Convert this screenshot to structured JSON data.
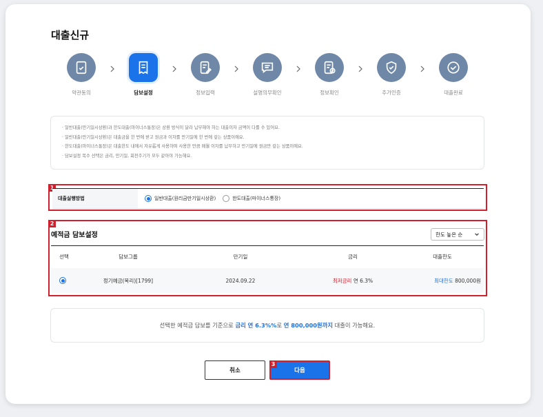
{
  "page": {
    "title": "대출신규"
  },
  "steps": [
    {
      "label": "약관동의",
      "icon": "document-check-icon",
      "active": false
    },
    {
      "label": "담보설정",
      "icon": "receipt-icon",
      "active": true
    },
    {
      "label": "정보입력",
      "icon": "document-edit-icon",
      "active": false
    },
    {
      "label": "설명의무확인",
      "icon": "message-icon",
      "active": false
    },
    {
      "label": "정보확인",
      "icon": "document-verified-icon",
      "active": false
    },
    {
      "label": "추가인증",
      "icon": "shield-check-icon",
      "active": false
    },
    {
      "label": "대출완료",
      "icon": "check-circle-icon",
      "active": false
    }
  ],
  "notice": [
    "일반대출(만기일시상환)과 한도대출(마이너스통장)은 상환 방식이 달라 납부해야 하는 대출이자 금액이 다를 수 있어요.",
    "일반대출(만기일시상환)은 대출금을 한 번에 받고 원금과 이자를 만기일에 한 번에 갚는 상품이에요.",
    "한도대출(마이너스통장)은 대출한도 내에서 자유롭게 사용하며 사용한 만큼 매월 이자를 납부하고 만기일에 원금만 갚는 상품이에요.",
    "담보설정 복수 선택은 금리, 만기일, 회전주기가 모두 같아야 가능해요."
  ],
  "highlights": [
    "1",
    "2",
    "3"
  ],
  "method": {
    "label": "대출실행방법",
    "options": [
      {
        "label": "일반대출(원리금만기일시상환)",
        "selected": true
      },
      {
        "label": "한도대출(마이너스통장)",
        "selected": false
      }
    ]
  },
  "collateral": {
    "title": "예적금 담보설정",
    "sort": "한도 높은 순",
    "headers": [
      "선택",
      "담보그룹",
      "만기일",
      "금리",
      "대출한도"
    ],
    "rows": [
      {
        "group": "정기예금(복리)[1799]",
        "maturity": "2024.09.22",
        "rate_label": "최저금리",
        "rate": "연 6.3%",
        "limit_label": "최대한도",
        "limit": "800,000원"
      }
    ]
  },
  "summary": {
    "pre": "선택한 예적금 담보를 기준으로 ",
    "rate": "금리 연 6.3%%",
    "mid": "로 ",
    "amount": "연 800,000원까지",
    "post": " 대출이 가능해요."
  },
  "buttons": {
    "cancel": "취소",
    "next": "다음"
  },
  "colors": {
    "accent": "#1a73e8",
    "step_inactive": "#6f88a8",
    "highlight": "#d0202e"
  }
}
